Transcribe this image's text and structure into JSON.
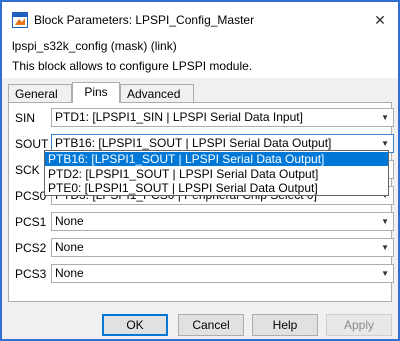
{
  "window": {
    "title": "Block Parameters: LPSPI_Config_Master",
    "close_label": "✕"
  },
  "header": {
    "mask_line": "lpspi_s32k_config (mask) (link)",
    "description": "This block allows to configure LPSPI module."
  },
  "tabs": [
    {
      "label": "General"
    },
    {
      "label": "Pins"
    },
    {
      "label": "Advanced"
    }
  ],
  "active_tab": "Pins",
  "rows": {
    "sin": {
      "label": "SIN",
      "value": "PTD1: [LPSPI1_SIN | LPSPI Serial Data Input]"
    },
    "sout": {
      "label": "SOUT",
      "value": "PTB16: [LPSPI1_SOUT | LPSPI Serial Data Output]"
    },
    "sck": {
      "label": "SCK",
      "value": ""
    },
    "pcs0": {
      "label": "PCS0",
      "value": "PTD3: [LPSPI1_PCS0 | Peripheral Chip Select 0]"
    },
    "pcs1": {
      "label": "PCS1",
      "value": "None"
    },
    "pcs2": {
      "label": "PCS2",
      "value": "None"
    },
    "pcs3": {
      "label": "PCS3",
      "value": "None"
    }
  },
  "dropdown": {
    "options": [
      "PTB16: [LPSPI1_SOUT | LPSPI Serial Data Output]",
      "PTD2: [LPSPI1_SOUT | LPSPI Serial Data Output]",
      "PTE0: [LPSPI1_SOUT | LPSPI Serial Data Output]"
    ],
    "selected_index": 0
  },
  "buttons": {
    "ok": "OK",
    "cancel": "Cancel",
    "help": "Help",
    "apply": "Apply"
  },
  "colors": {
    "window_border": "#2f6fd1",
    "selection": "#0078d7",
    "icon_orange": "#e8731a",
    "icon_blue": "#1f5fbf"
  }
}
